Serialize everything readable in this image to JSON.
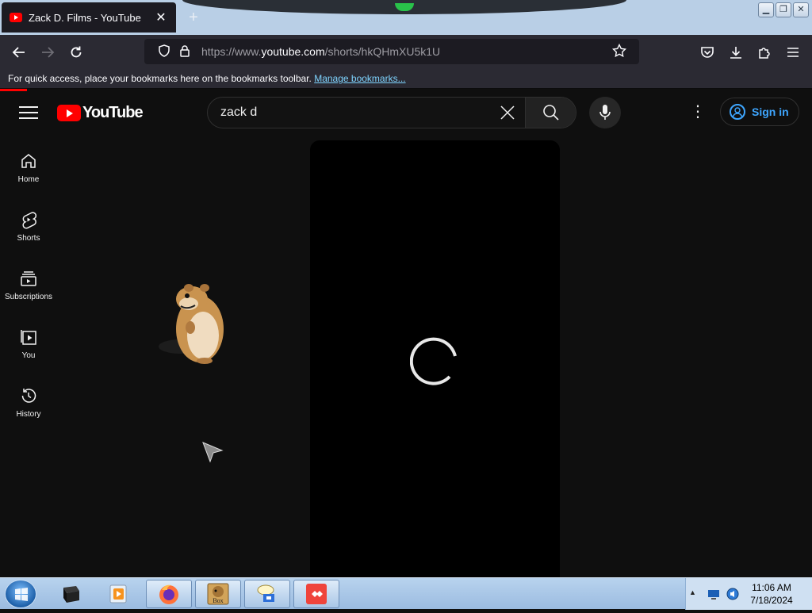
{
  "browser": {
    "tab_title": "Zack D. Films - YouTube",
    "new_tab": "+",
    "url_prefix": "https://www.",
    "url_domain": "youtube.com",
    "url_path": "/shorts/hkQHmXU5k1U",
    "bookmarks_hint": "For quick access, place your bookmarks here on the bookmarks toolbar.",
    "bookmarks_link": "Manage bookmarks..."
  },
  "youtube": {
    "logo_text": "YouTube",
    "search_value": "zack d",
    "signin_label": "Sign in",
    "sidebar": [
      {
        "label": "Home",
        "icon": "home-icon"
      },
      {
        "label": "Shorts",
        "icon": "shorts-icon"
      },
      {
        "label": "Subscriptions",
        "icon": "subscriptions-icon"
      },
      {
        "label": "You",
        "icon": "you-icon"
      },
      {
        "label": "History",
        "icon": "history-icon"
      }
    ]
  },
  "taskbar": {
    "time": "11:06 AM",
    "date": "7/18/2024",
    "box_label": "Box"
  },
  "colors": {
    "yt_red": "#ff0000",
    "link_blue": "#3ea6ff",
    "page_bg": "#0f0f0f",
    "browser_chrome": "#2b2a33"
  }
}
